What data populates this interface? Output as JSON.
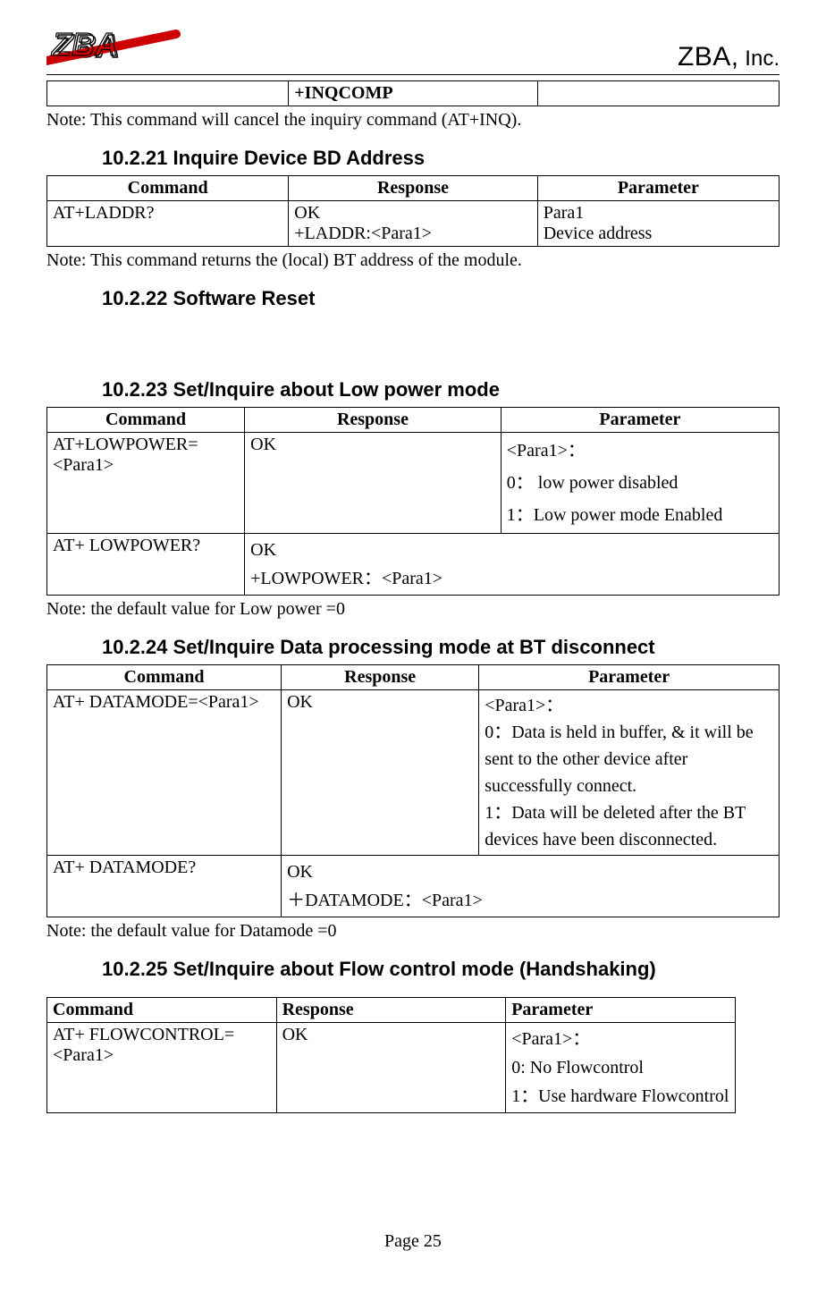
{
  "header": {
    "company": "ZBA,",
    "inc": " Inc."
  },
  "inqcomp_table": {
    "rows": [
      {
        "c1": "",
        "c2": "+INQCOMP",
        "c3": ""
      }
    ]
  },
  "note_inqcomp": "Note: This command will cancel the inquiry command (AT+INQ).",
  "section_10221": "10.2.21 Inquire Device BD Address",
  "laddr_table": {
    "head": {
      "c1": "Command",
      "c2": "Response",
      "c3": "Parameter"
    },
    "rows": [
      {
        "c1": "AT+LADDR?",
        "c2": "OK\n+LADDR:<Para1>",
        "c3": "Para1\nDevice address"
      }
    ]
  },
  "note_laddr": "Note: This command returns the (local) BT address of the module.",
  "section_10222": "10.2.22 Software Reset",
  "section_10223": "10.2.23 Set/Inquire about Low power mode",
  "lowpower_table": {
    "head": {
      "c1": "Command",
      "c2": "Response",
      "c3": "Parameter"
    },
    "rows": [
      {
        "c1": "AT+LOWPOWER=<Para1>",
        "c2": "OK",
        "c3": "<Para1>：\n0： low power disabled\n1：Low power mode Enabled"
      },
      {
        "c1": "AT+ LOWPOWER?",
        "c2": "OK\n+LOWPOWER：<Para1>",
        "c3": ""
      }
    ]
  },
  "note_lowpower": "Note: the default value for Low power =0",
  "section_10224": "10.2.24 Set/Inquire Data processing mode at BT disconnect",
  "datamode_table": {
    "head": {
      "c1": "Command",
      "c2": "Response",
      "c3": "Parameter"
    },
    "rows": [
      {
        "c1": "AT+ DATAMODE=<Para1>",
        "c2": "OK",
        "c3": "<Para1>：\n0：Data is held in buffer, & it will be sent to the other device after successfully connect.\n1：Data will be deleted after the BT devices have been disconnected."
      },
      {
        "c1": "AT+ DATAMODE?",
        "c2": "OK\n＋DATAMODE：<Para1>",
        "c3": ""
      }
    ]
  },
  "note_datamode": "Note: the default value for Datamode =0",
  "section_10225": "10.2.25 Set/Inquire about Flow control mode (Handshaking)",
  "flow_table": {
    "head": {
      "c1": "Command",
      "c2": "Response",
      "c3": "Parameter"
    },
    "rows": [
      {
        "c1": "AT+ FLOWCONTROL=<Para1>",
        "c2": "OK",
        "c3": "<Para1>：\n0: No Flowcontrol\n1：Use hardware Flowcontrol"
      }
    ]
  },
  "page_number": "Page 25"
}
